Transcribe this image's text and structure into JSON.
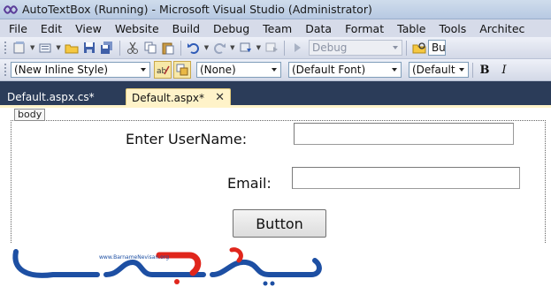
{
  "window": {
    "title": "AutoTextBox (Running) - Microsoft Visual Studio (Administrator)"
  },
  "menu": {
    "items": [
      "File",
      "Edit",
      "View",
      "Website",
      "Build",
      "Debug",
      "Team",
      "Data",
      "Format",
      "Table",
      "Tools",
      "Architec"
    ]
  },
  "toolbar1": {
    "debug_config": "Debug",
    "find_combo": "Bu"
  },
  "toolbar2": {
    "style_combo": "(New Inline Style)",
    "target_rule_combo": "(None)",
    "font_combo": "(Default Font)",
    "size_combo": "(Default",
    "bold_label": "B",
    "italic_label": "I"
  },
  "tabs": [
    {
      "label": "Default.aspx.cs*",
      "active": false
    },
    {
      "label": "Default.aspx*",
      "active": true,
      "close": "✕"
    }
  ],
  "designer": {
    "body_tag": "body",
    "username_label": "Enter UserName:",
    "username_value": "",
    "email_label": "Email:",
    "email_value": "",
    "button_label": "Button"
  },
  "watermark": {
    "site": "www.BarnameNevisan.org",
    "logo_text": "برنامه نویسان",
    "colors": {
      "primary": "#1d4fa3",
      "accent": "#e0261c"
    }
  },
  "colors": {
    "tab_strip": "#2b3c59",
    "active_tab": "#fff3c9",
    "menu_bar": "#d6dbe9",
    "toolbar": "#e3e7f1"
  }
}
